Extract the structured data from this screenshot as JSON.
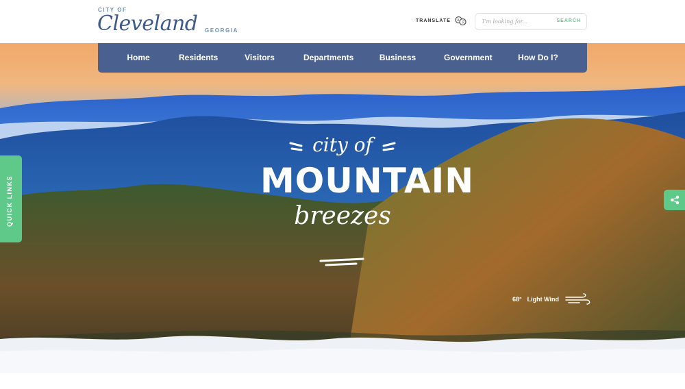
{
  "logo": {
    "city_of": "CITY OF",
    "name": "Cleveland",
    "state": "GEORGIA"
  },
  "header": {
    "translate_label": "TRANSLATE",
    "search": {
      "placeholder": "I'm looking for...",
      "button_label": "SEARCH"
    }
  },
  "nav": {
    "items": [
      {
        "label": "Home"
      },
      {
        "label": "Residents"
      },
      {
        "label": "Visitors"
      },
      {
        "label": "Departments"
      },
      {
        "label": "Business"
      },
      {
        "label": "Government"
      },
      {
        "label": "How Do I?"
      }
    ]
  },
  "hero": {
    "tagline_line1": "city of",
    "tagline_line2": "MOUNTAIN",
    "tagline_line3": "breezes"
  },
  "weather": {
    "temp": "68",
    "unit": "°",
    "condition": "Light Wind"
  },
  "sidebar": {
    "quick_links_label": "QUICK LINKS"
  },
  "colors": {
    "nav_bg": "#4a618f",
    "accent_green": "#5fc98a",
    "logo_blue": "#3c5a8c"
  },
  "icons": {
    "translate": "translate-icon",
    "share": "share-icon",
    "wind": "wind-icon"
  }
}
